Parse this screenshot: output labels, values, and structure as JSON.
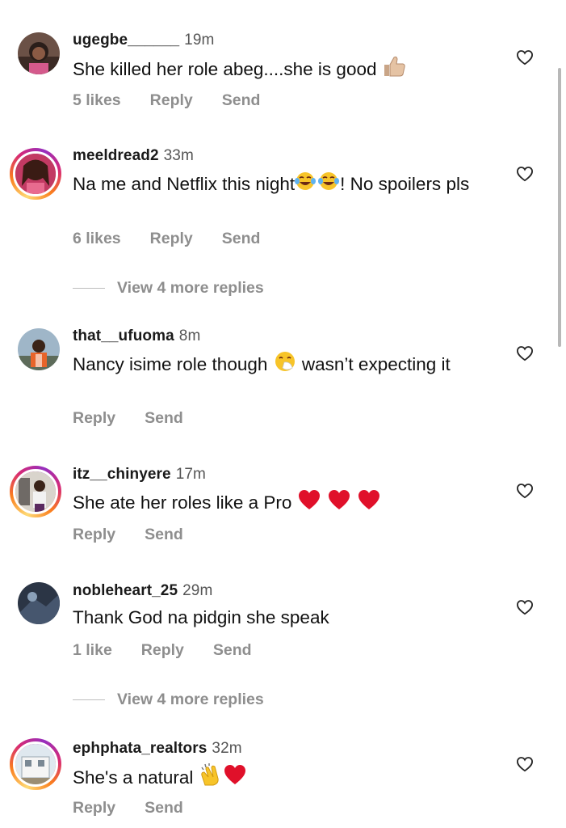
{
  "comments": [
    {
      "username": "ugegbe______",
      "time": "19m",
      "text": "She killed her role abeg....she is good",
      "emoji": "thumbs-up",
      "likes": "5 likes",
      "reply": "Reply",
      "send": "Send"
    },
    {
      "username": "meeldread2",
      "time": "33m",
      "text_before": "Na me and Netflix this night",
      "text_after": "! No spoilers pls",
      "emoji": "tears-of-joy",
      "likes": "6 likes",
      "reply": "Reply",
      "send": "Send",
      "view_more": "View 4 more replies"
    },
    {
      "username": "that__ufuoma",
      "time": "8m",
      "text_before": "Nancy isime role though",
      "text_after": "wasn’t expecting it",
      "emoji": "sneezing-face",
      "reply": "Reply",
      "send": "Send"
    },
    {
      "username": "itz__chinyere",
      "time": "17m",
      "text": "She ate her roles like a Pro",
      "emoji": "red-hearts",
      "reply": "Reply",
      "send": "Send"
    },
    {
      "username": "nobleheart_25",
      "time": "29m",
      "text": "Thank God na pidgin she speak",
      "likes": "1 like",
      "reply": "Reply",
      "send": "Send",
      "view_more": "View 4 more replies"
    },
    {
      "username": "ephphata_realtors",
      "time": "32m",
      "text": "She's a natural",
      "emoji": "clapping-hands-heart",
      "reply": "Reply",
      "send": "Send"
    }
  ],
  "colors": {
    "meta_text": "#8e8e8e",
    "story_ring": "#d62976",
    "heart_red": "#e0102a"
  }
}
